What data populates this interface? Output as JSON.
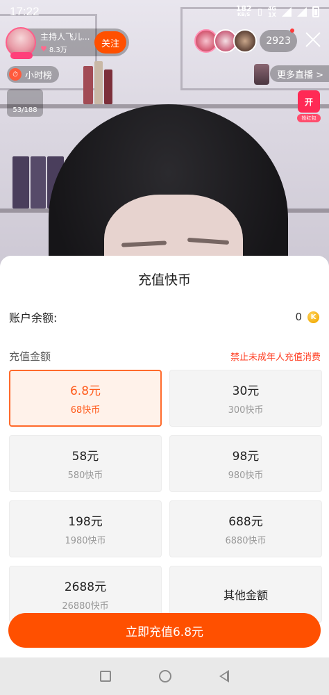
{
  "status_bar": {
    "time": "17:22",
    "net_speed": "182",
    "net_unit": "KB/S",
    "network": "4G",
    "network_sub": "1X"
  },
  "live": {
    "host_name": "主持人飞儿...",
    "host_likes": "8.3万",
    "follow_label": "关注",
    "viewer_count": "2923",
    "hour_rank": "小时榜",
    "more_live": "更多直播 >",
    "counter": "53/188",
    "red_packet_icon": "开",
    "red_packet_label": "抢红包"
  },
  "sheet": {
    "title": "充值快币",
    "balance_label": "账户余额:",
    "balance_value": "0",
    "coin_symbol": "K",
    "amount_label": "充值金额",
    "minor_warning": "禁止未成年人充值消费",
    "options": [
      {
        "amount": "6.8元",
        "coins": "68快币"
      },
      {
        "amount": "30元",
        "coins": "300快币"
      },
      {
        "amount": "58元",
        "coins": "580快币"
      },
      {
        "amount": "98元",
        "coins": "980快币"
      },
      {
        "amount": "198元",
        "coins": "1980快币"
      },
      {
        "amount": "688元",
        "coins": "6880快币"
      },
      {
        "amount": "2688元",
        "coins": "26880快币"
      },
      {
        "amount": "其他金额",
        "coins": ""
      }
    ],
    "selected_index": 0,
    "pay_button": "立即充值6.8元"
  },
  "colors": {
    "accent": "#ff5000",
    "selected_bg": "#fff2ea",
    "warning": "#ff3b1f",
    "coin": "#f2a900"
  },
  "icons": {
    "close": "close-icon",
    "coin": "coin-icon",
    "heart": "heart-icon",
    "nav_recent": "recent-apps-icon",
    "nav_home": "home-icon",
    "nav_back": "back-icon"
  }
}
